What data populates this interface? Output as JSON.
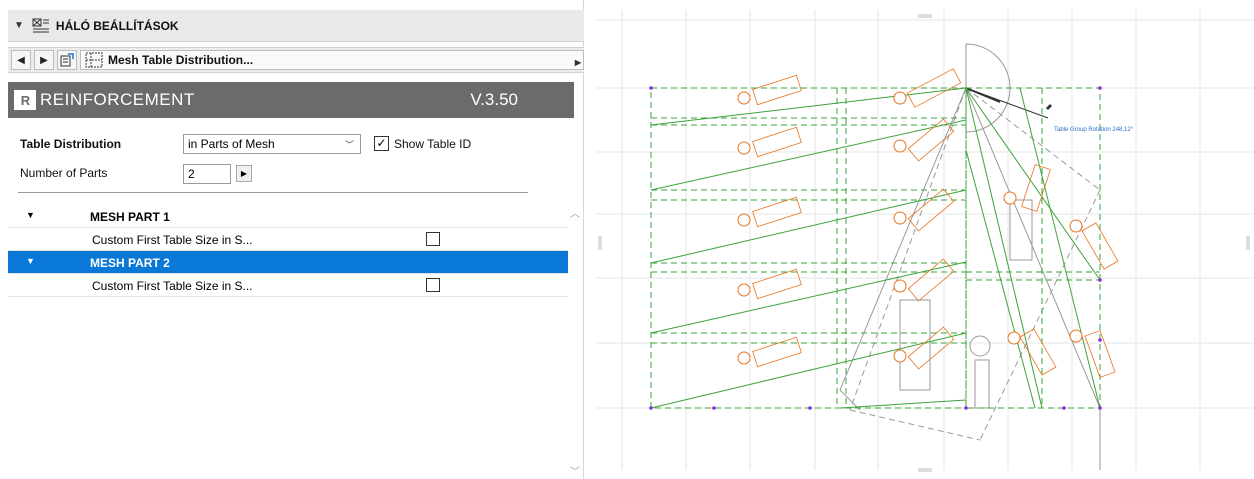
{
  "header": {
    "title": "HÁLÓ BEÁLLÍTÁSOK"
  },
  "nav": {
    "selected": "Mesh Table Distribution..."
  },
  "banner": {
    "name": "REINFORCEMENT",
    "version": "V.3.50"
  },
  "form": {
    "table_distribution_label": "Table Distribution",
    "table_distribution_value": "in Parts of Mesh",
    "show_table_id_label": "Show Table ID",
    "show_table_id_checked": true,
    "number_of_parts_label": "Number of Parts",
    "number_of_parts_value": "2"
  },
  "list": {
    "part1_title": "MESH PART 1",
    "part1_item": "Custom First Table Size in S...",
    "part2_title": "MESH PART 2",
    "part2_item": "Custom First Table Size in S..."
  },
  "drawing": {
    "group_rotation_label": "Table Group Rotation  248,12°",
    "line_color": "#3aa33a",
    "label_color": "#e8731c"
  },
  "colors": {
    "selection": "#0a78d7",
    "banner": "#6b6b6b"
  }
}
